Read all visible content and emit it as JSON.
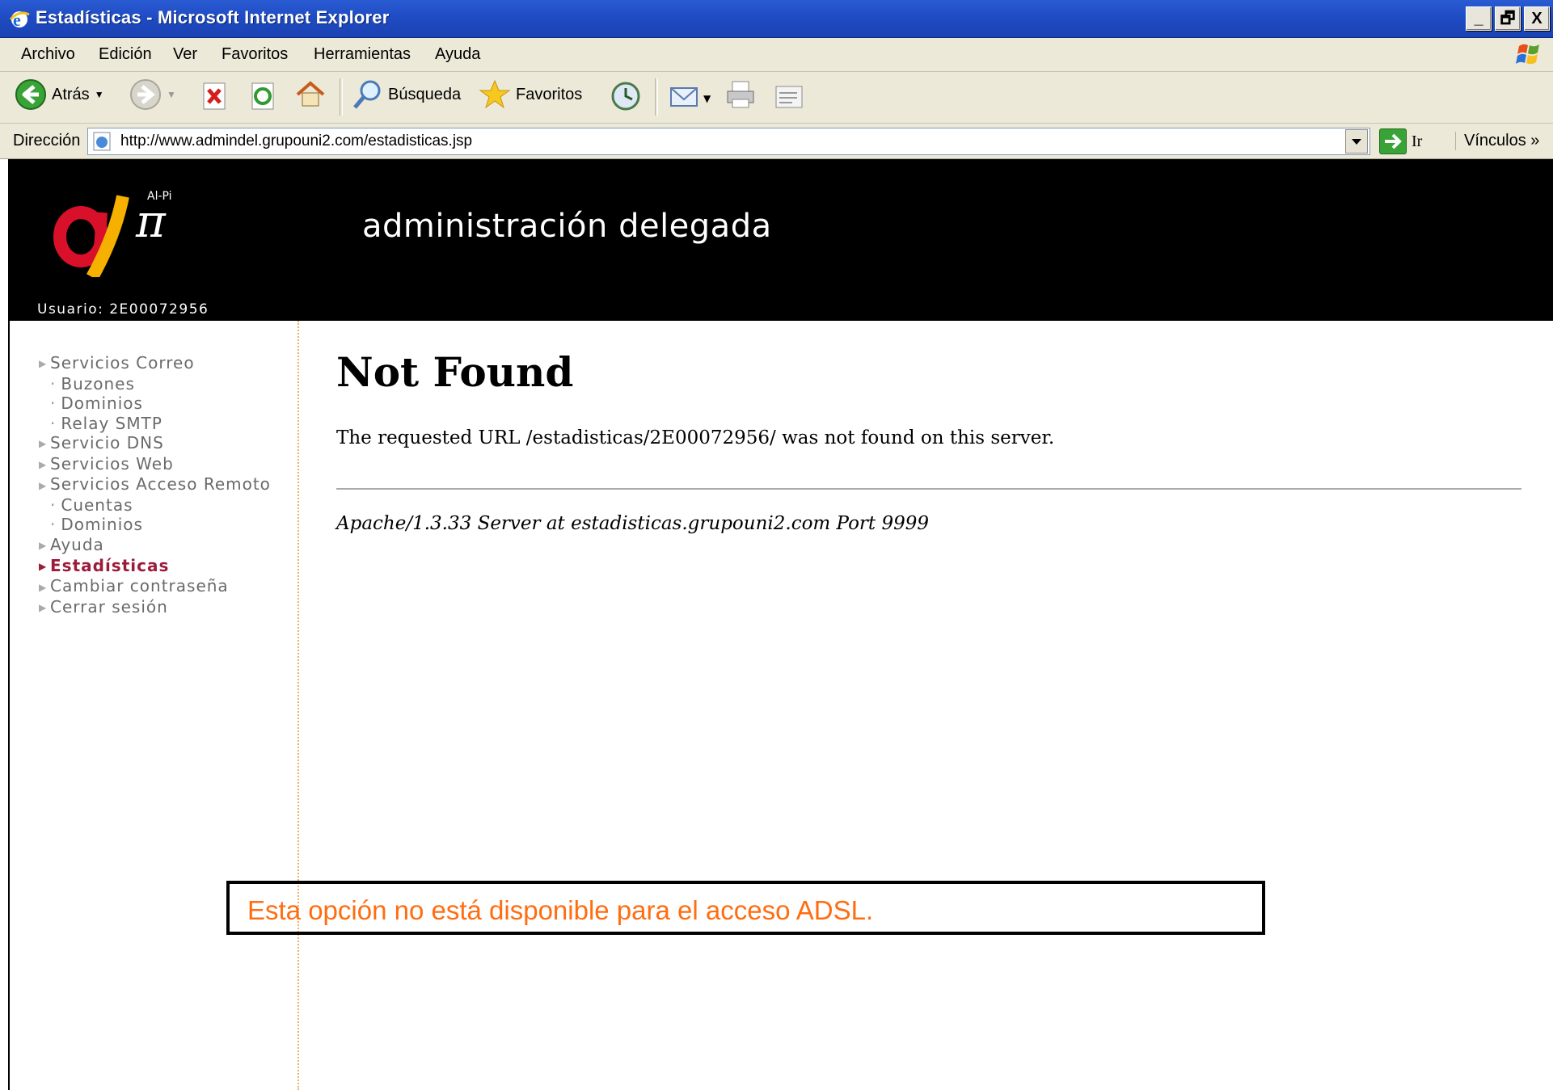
{
  "window": {
    "title": "Estadísticas - Microsoft Internet Explorer",
    "buttons": [
      "_",
      "🗗",
      "X"
    ]
  },
  "menu": [
    "Archivo",
    "Edición",
    "Ver",
    "Favoritos",
    "Herramientas",
    "Ayuda"
  ],
  "toolbar": {
    "back_label": "Atrás",
    "search_label": "Búsqueda",
    "favorites_label": "Favoritos"
  },
  "address": {
    "label": "Dirección",
    "url": "http://www.admindel.grupouni2.com/estadisticas.jsp",
    "go_label": "Ir",
    "links_label": "Vínculos »"
  },
  "site": {
    "tagline": "administración delegada",
    "user": "Usuario: 2E00072956",
    "logo_text": "Al-Pi"
  },
  "nav": [
    {
      "label": "Servicios Correo",
      "level": 0
    },
    {
      "label": "Buzones",
      "level": 1
    },
    {
      "label": "Dominios",
      "level": 1
    },
    {
      "label": "Relay SMTP",
      "level": 1
    },
    {
      "label": "Servicio DNS",
      "level": 0
    },
    {
      "label": "Servicios Web",
      "level": 0
    },
    {
      "label": "Servicios Acceso Remoto",
      "level": 0
    },
    {
      "label": "Cuentas",
      "level": 1
    },
    {
      "label": "Dominios",
      "level": 1
    },
    {
      "label": "Ayuda",
      "level": 0
    },
    {
      "label": "Estadísticas",
      "level": 0,
      "active": true
    },
    {
      "label": "Cambiar contraseña",
      "level": 0
    },
    {
      "label": "Cerrar sesión",
      "level": 0
    }
  ],
  "error": {
    "title": "Not Found",
    "message": "The requested URL /estadisticas/2E00072956/ was not found on this server.",
    "server": "Apache/1.3.33 Server at estadisticas.grupouni2.com Port 9999"
  },
  "notice": "Esta opción no está disponible para el acceso ADSL.",
  "colors": {
    "active_nav": "#9d1b3a",
    "notice_text": "#ff6d10",
    "titlebar": "#1f4cc4"
  }
}
